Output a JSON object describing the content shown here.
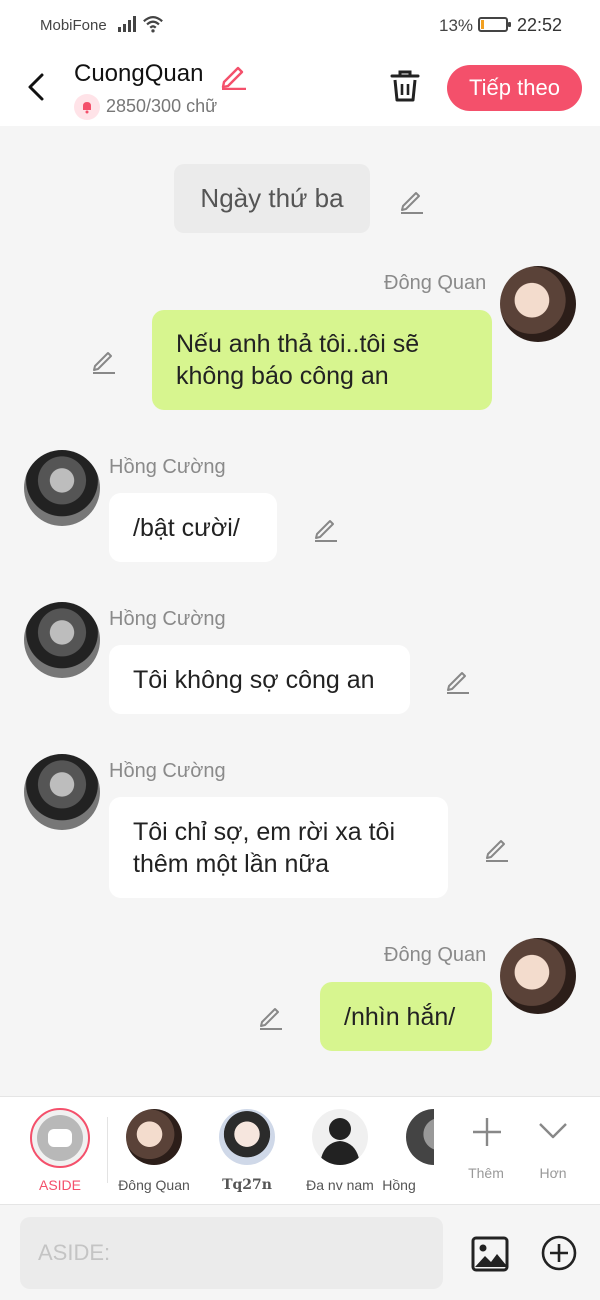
{
  "status": {
    "carrier": "MobiFone",
    "battery": "13%",
    "battery_level": 0.13,
    "time": "22:52"
  },
  "header": {
    "title": "CuongQuan",
    "counter": "2850/300 chữ",
    "next_label": "Tiếp theo",
    "accent": "#f4506b"
  },
  "chat": {
    "narration": "Ngày thứ ba",
    "messages": [
      {
        "sender": "Đông Quan",
        "side": "right",
        "text": "Nếu anh thả tôi..tôi sẽ không báo công an"
      },
      {
        "sender": "Hồng Cường",
        "side": "left",
        "text": "/bật cười/"
      },
      {
        "sender": "Hồng Cường",
        "side": "left",
        "text": "Tôi không sợ công an"
      },
      {
        "sender": "Hồng Cường",
        "side": "left",
        "text": "Tôi chỉ sợ, em rời xa tôi thêm một lần nữa"
      },
      {
        "sender": "Đông Quan",
        "side": "right",
        "text": "/nhìn hắn/"
      }
    ],
    "my_bubble_color": "#d7f58f"
  },
  "characters": {
    "aside_label": "ASIDE",
    "items": [
      {
        "label": "Đông Quan"
      },
      {
        "label": "Tq27n"
      },
      {
        "label": "Đa nv nam"
      },
      {
        "label": "Hồng"
      }
    ],
    "more_label": "Thêm",
    "collapse_label": "Hơn"
  },
  "input": {
    "placeholder": "ASIDE:"
  }
}
